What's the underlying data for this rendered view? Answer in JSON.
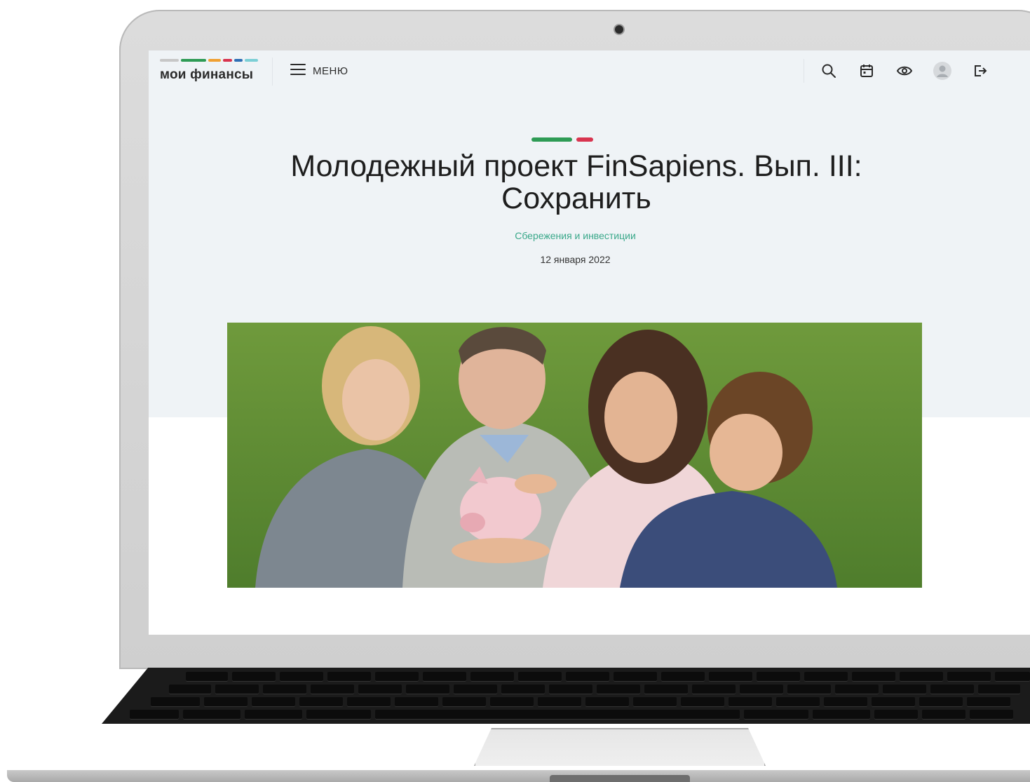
{
  "site": {
    "logo_text": "мои финансы",
    "logo_stripe_colors": [
      "#c7c7c7",
      "#2e9b55",
      "#f0a032",
      "#d8344f",
      "#2f6fb5",
      "#7ccfd6"
    ],
    "menu_label": "МЕНЮ",
    "icons": [
      "search-icon",
      "calendar-icon",
      "eye-icon",
      "user-avatar",
      "logout-icon"
    ]
  },
  "article": {
    "title_line1": "Молодежный проект FinSapiens. Вып. III:",
    "title_line2": "Сохранить",
    "category": "Сбережения и инвестиции",
    "date": "12 января 2022",
    "accent_colors": [
      "#2e9b55",
      "#d8344f"
    ],
    "image": "family-with-piggy-bank-photo"
  },
  "colors": {
    "hero_background": "#eff3f6",
    "category_text": "#3aa88a"
  }
}
